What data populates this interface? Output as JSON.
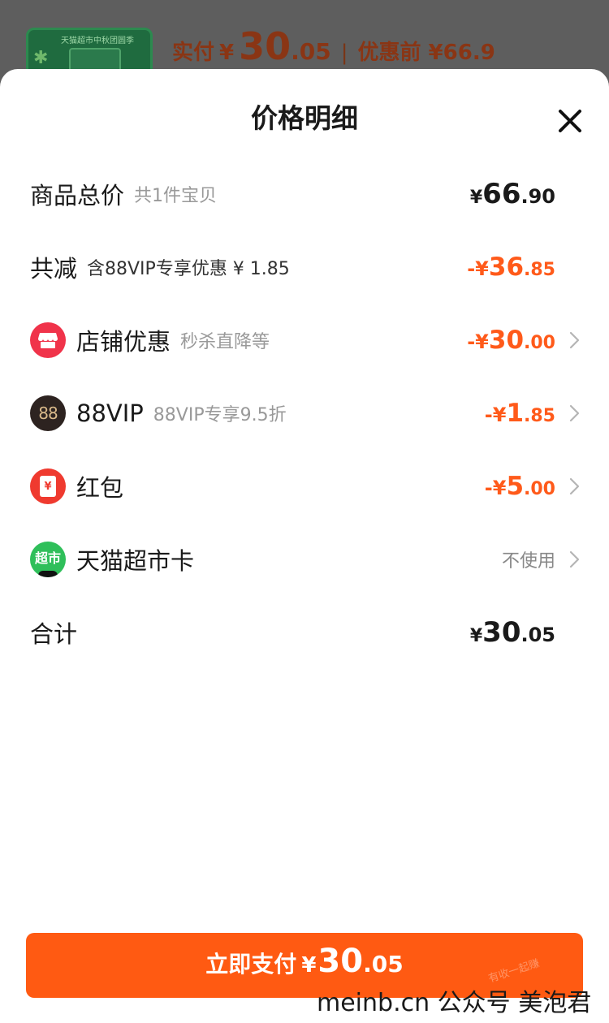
{
  "background": {
    "thumb_text": "天猫超市中秋团圆季",
    "paid_label": "实付",
    "paid_yen": "¥",
    "paid_int": "30",
    "paid_dec": ".05",
    "separator": "|",
    "original_label": "优惠前 ¥66.9"
  },
  "sheet": {
    "title": "价格明细"
  },
  "rows": {
    "total": {
      "label": "商品总价",
      "sub": "共1件宝贝",
      "yen": "¥",
      "int": "66",
      "dec": ".90"
    },
    "reduced": {
      "label": "共减",
      "sub": "含88VIP专享优惠 ¥ 1.85",
      "yen": "-¥",
      "int": "36",
      "dec": ".85"
    },
    "shop": {
      "label": "店铺优惠",
      "sub": "秒杀直降等",
      "yen": "-¥",
      "int": "30",
      "dec": ".00"
    },
    "vip": {
      "icon_text": "88",
      "label": "88VIP",
      "sub": "88VIP专享9.5折",
      "yen": "-¥",
      "int": "1",
      "dec": ".85"
    },
    "redpacket": {
      "icon_text": "¥",
      "label": "红包",
      "yen": "-¥",
      "int": "5",
      "dec": ".00"
    },
    "tmallcard": {
      "icon_text": "超市",
      "label": "天猫超市卡",
      "status": "不使用"
    },
    "sum": {
      "label": "合计",
      "yen": "¥",
      "int": "30",
      "dec": ".05"
    }
  },
  "pay_button": {
    "label": "立即支付",
    "yen": "¥",
    "int": "30",
    "dec": ".05"
  },
  "watermark": {
    "text": "meinb.cn  公众号 美泡君",
    "faint": "有收一起赚"
  },
  "colors": {
    "accent_orange": "#ff5a12",
    "amount_orange": "#ff5a1a",
    "shop_icon_red": "#f0334a",
    "vip_icon_dark": "#2d2320",
    "redpacket_icon_red": "#ef3a2f",
    "tmall_icon_green": "#2fbf5a"
  }
}
